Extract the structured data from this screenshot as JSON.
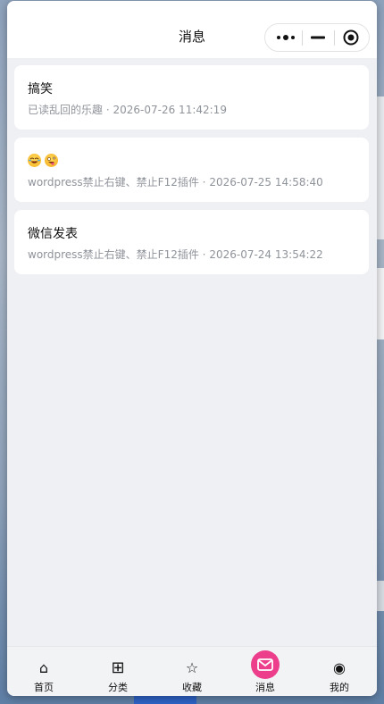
{
  "navbar": {
    "title": "消息"
  },
  "capsule": {
    "more_icon": "more-dots-icon",
    "minimize_icon": "minimize-icon",
    "close_icon": "target-circle-icon"
  },
  "messages": [
    {
      "title": "搞笑",
      "source": "已读乱回的乐趣",
      "separator": "·",
      "time": "2026-07-26 11:42:19"
    },
    {
      "title": "",
      "emoji": [
        "rolling-laughing-emoji",
        "zany-face-emoji"
      ],
      "source": "wordpress禁止右键、禁止F12插件",
      "separator": "·",
      "time": "2026-07-25 14:58:40"
    },
    {
      "title": "微信发表",
      "source": "wordpress禁止右键、禁止F12插件",
      "separator": "·",
      "time": "2026-07-24 13:54:22"
    }
  ],
  "tabbar": {
    "items": [
      {
        "label": "首页",
        "icon": "home-icon",
        "glyph": "⌂"
      },
      {
        "label": "分类",
        "icon": "grid-icon",
        "glyph": "⊞"
      },
      {
        "label": "收藏",
        "icon": "star-icon",
        "glyph": "☆"
      },
      {
        "label": "消息",
        "icon": "mail-icon",
        "glyph": ""
      },
      {
        "label": "我的",
        "icon": "profile-icon",
        "glyph": "◉"
      }
    ],
    "active_index": 3,
    "accent_color": "#ec3e8b"
  }
}
